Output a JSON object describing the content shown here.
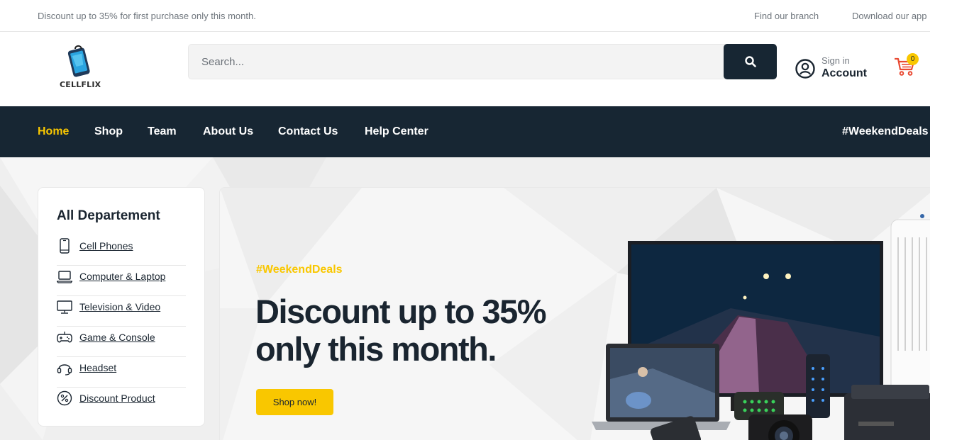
{
  "topbar": {
    "promo": "Discount up to 35% for first purchase only this month.",
    "find_branch": "Find our branch",
    "download_app": "Download our app"
  },
  "header": {
    "logo_text": "CELLFLIX",
    "search_placeholder": "Search...",
    "sign_in": "Sign in",
    "account": "Account",
    "cart_count": "0"
  },
  "nav": {
    "items": [
      {
        "label": "Home",
        "active": true
      },
      {
        "label": "Shop"
      },
      {
        "label": "Team"
      },
      {
        "label": "About Us"
      },
      {
        "label": "Contact Us"
      },
      {
        "label": "Help Center"
      }
    ],
    "deals": "#WeekendDeals"
  },
  "departments": {
    "title": "All Departement",
    "items": [
      {
        "label": "Cell Phones",
        "icon": "phone-icon"
      },
      {
        "label": "Computer & Laptop",
        "icon": "laptop-icon"
      },
      {
        "label": "Television & Video",
        "icon": "tv-icon"
      },
      {
        "label": "Game & Console",
        "icon": "gamepad-icon"
      },
      {
        "label": "Headset",
        "icon": "headset-icon"
      },
      {
        "label": "Discount Product",
        "icon": "discount-icon"
      }
    ]
  },
  "hero": {
    "tag": "#WeekendDeals",
    "headline": "Discount up to 35% only this month.",
    "cta": "Shop now!"
  },
  "colors": {
    "accent": "#f9c700",
    "navy": "#172633",
    "cart": "#e94a33"
  }
}
